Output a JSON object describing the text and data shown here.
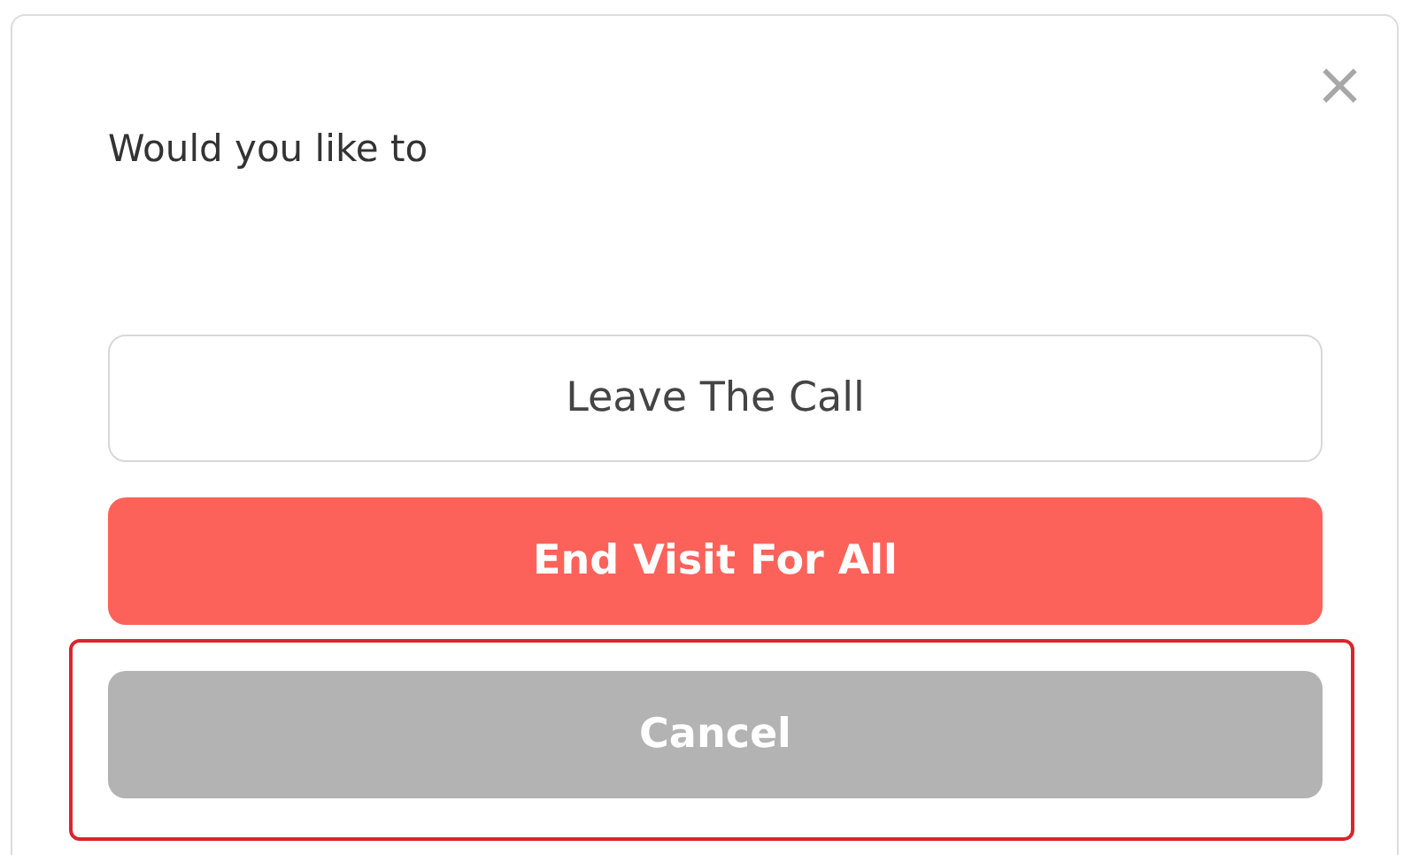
{
  "dialog": {
    "close": "×",
    "prompt": "Would you like to",
    "buttons": [
      {
        "label": "Leave The Call",
        "kind": "outline",
        "highlighted": false
      },
      {
        "label": "End Visit For All",
        "kind": "danger",
        "highlighted": false
      },
      {
        "label": "Cancel",
        "kind": "neutral",
        "highlighted": true
      }
    ]
  }
}
